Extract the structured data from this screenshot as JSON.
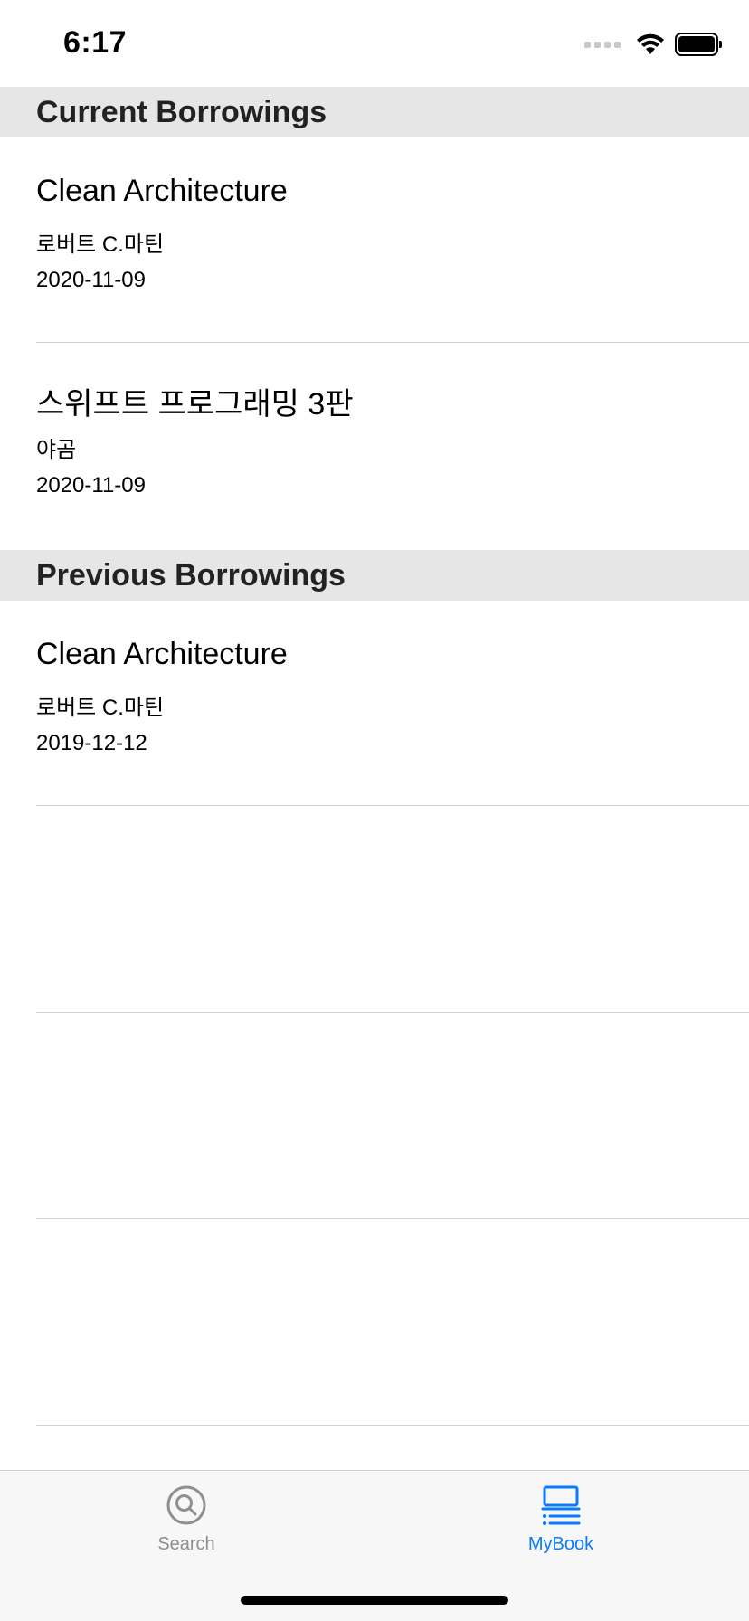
{
  "status_bar": {
    "time": "6:17"
  },
  "sections": [
    {
      "header": "Current Borrowings",
      "items": [
        {
          "title": "Clean Architecture",
          "author": "로버트 C.마틴",
          "date": "2020-11-09"
        },
        {
          "title": "스위프트 프로그래밍 3판",
          "author": "야곰",
          "date": "2020-11-09"
        }
      ]
    },
    {
      "header": "Previous Borrowings",
      "items": [
        {
          "title": "Clean Architecture",
          "author": "로버트 C.마틴",
          "date": "2019-12-12"
        }
      ]
    }
  ],
  "tab_bar": {
    "tabs": [
      {
        "label": "Search",
        "icon": "search-icon",
        "selected": false
      },
      {
        "label": "MyBook",
        "icon": "laptop-list-icon",
        "selected": true
      }
    ],
    "accent_color": "#0a7aff",
    "inactive_color": "#8e8e93"
  }
}
